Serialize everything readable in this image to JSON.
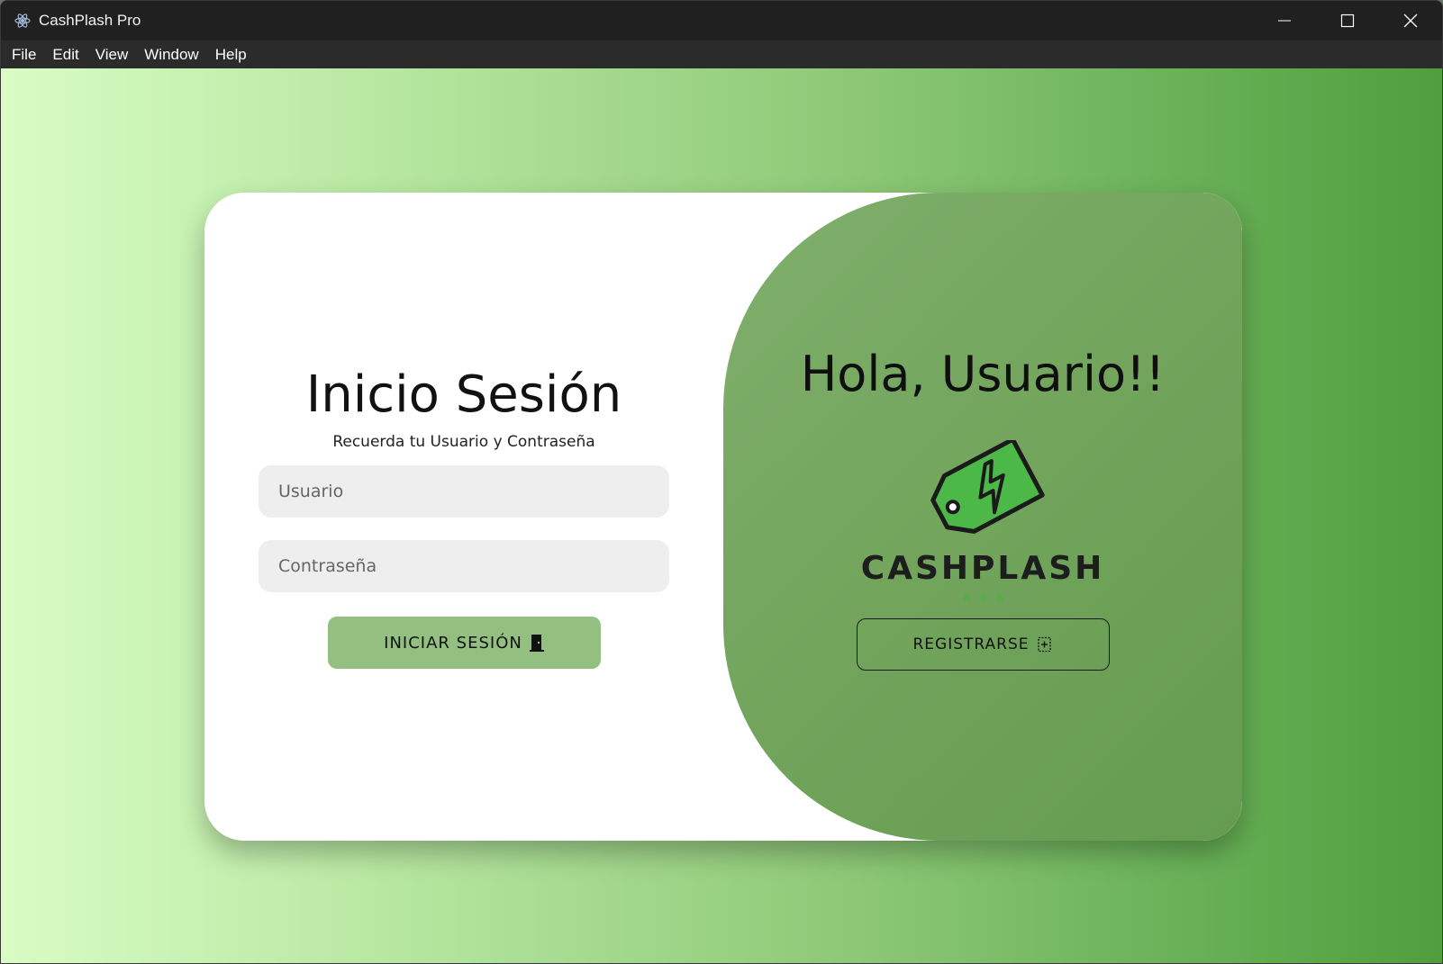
{
  "window": {
    "title": "CashPlash Pro",
    "app_icon": "electron-icon",
    "controls": [
      "minimize-icon",
      "maximize-icon",
      "close-icon"
    ]
  },
  "menu": {
    "items": [
      "File",
      "Edit",
      "View",
      "Window",
      "Help"
    ]
  },
  "login": {
    "title": "Inicio Sesión",
    "subtitle": "Recuerda tu Usuario y Contraseña",
    "username_placeholder": "Usuario",
    "username_value": "",
    "password_placeholder": "Contraseña",
    "password_value": "",
    "submit_label": "INICIAR SESIÓN",
    "submit_icon": "door-icon"
  },
  "welcome": {
    "title": "Hola, Usuario!!",
    "logo_icon": "price-tag-lightning-icon",
    "brand": "CASHPLASH",
    "register_label": "REGISTRARSE",
    "register_icon": "add-box-icon"
  },
  "colors": {
    "background_left": "#d8fcc4",
    "background_right": "#4f9e3e",
    "panel_green": "#72a45c",
    "login_button": "#93bf80",
    "logo_green": "#4cb848"
  }
}
